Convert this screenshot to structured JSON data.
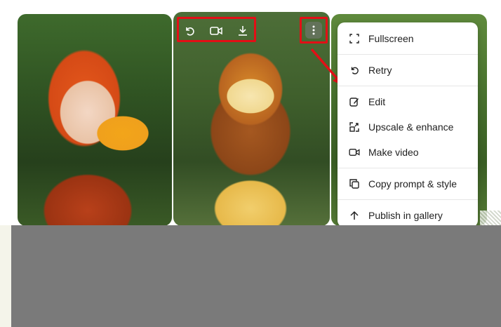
{
  "toolbar": {
    "buttons": [
      {
        "name": "retry",
        "icon": "undo-icon"
      },
      {
        "name": "video",
        "icon": "video-camera-icon"
      },
      {
        "name": "download",
        "icon": "download-icon"
      }
    ],
    "more_icon": "more-vertical-icon"
  },
  "menu": {
    "items": [
      {
        "label": "Fullscreen",
        "icon": "fullscreen-icon"
      },
      {
        "label": "Retry",
        "icon": "undo-icon"
      },
      {
        "label": "Edit",
        "icon": "edit-icon"
      },
      {
        "label": "Upscale & enhance",
        "icon": "upscale-icon"
      },
      {
        "label": "Make video",
        "icon": "video-camera-icon"
      },
      {
        "label": "Copy prompt & style",
        "icon": "copy-icon"
      },
      {
        "label": "Publish in gallery",
        "icon": "arrow-up-icon"
      }
    ]
  },
  "colors": {
    "highlight": "#e30f16",
    "overlay": "#7a7a7a"
  }
}
